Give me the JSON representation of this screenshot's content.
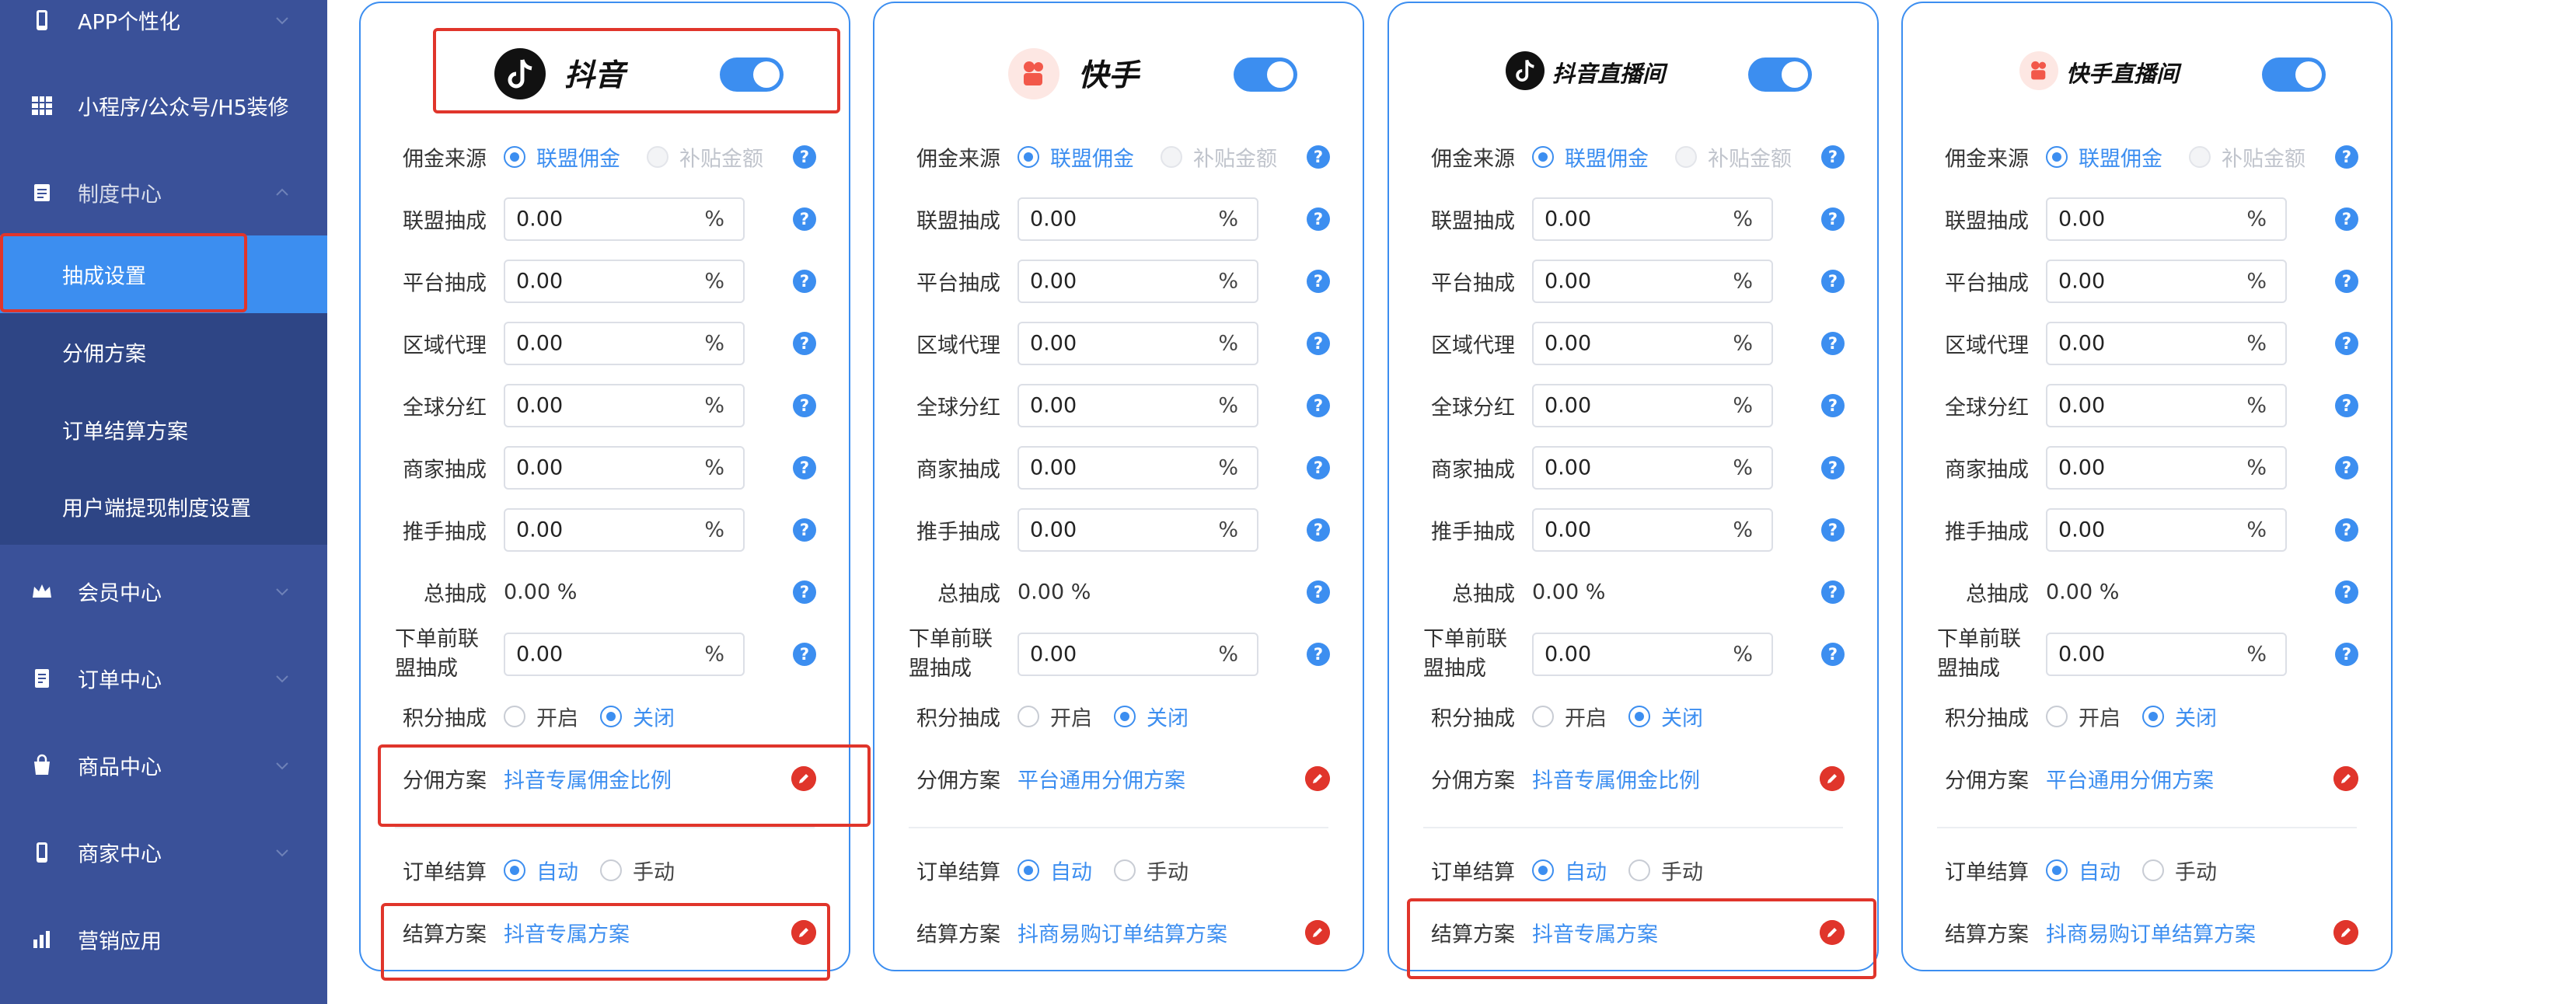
{
  "sidebar": {
    "items": [
      {
        "label": "APP个性化",
        "icon": "phone-icon"
      },
      {
        "label": "小程序/公众号/H5装修",
        "icon": "grid-icon"
      },
      {
        "label": "制度中心",
        "icon": "document-icon"
      },
      {
        "label": "会员中心",
        "icon": "crown-icon"
      },
      {
        "label": "订单中心",
        "icon": "order-icon"
      },
      {
        "label": "商品中心",
        "icon": "bag-icon"
      },
      {
        "label": "商家中心",
        "icon": "phone-icon"
      },
      {
        "label": "营销应用",
        "icon": "chart-icon"
      }
    ],
    "subitems": [
      {
        "label": "抽成设置",
        "active": true
      },
      {
        "label": "分佣方案"
      },
      {
        "label": "订单结算方案"
      },
      {
        "label": "用户端提现制度设置"
      }
    ]
  },
  "labels": {
    "commission_source": "佣金来源",
    "alliance": "联盟抽成",
    "platform": "平台抽成",
    "region": "区域代理",
    "global": "全球分红",
    "merchant": "商家抽成",
    "promoter": "推手抽成",
    "total": "总抽成",
    "pre_order": "下单前联盟抽成",
    "points": "积分抽成",
    "commission_plan": "分佣方案",
    "order_settle": "订单结算",
    "settle_plan": "结算方案",
    "opt_alliance_commission": "联盟佣金",
    "opt_subsidy": "补贴金额",
    "opt_on": "开启",
    "opt_off": "关闭",
    "opt_auto": "自动",
    "opt_manual": "手动",
    "percent": "%",
    "help": "?"
  },
  "colors": {
    "accent": "#3c8ef0",
    "sidebar": "#3a5199",
    "highlight": "#e0352b"
  },
  "cards": [
    {
      "name": "抖音",
      "enabled": true,
      "alliance": "0.00",
      "platform": "0.00",
      "region": "0.00",
      "global": "0.00",
      "merchant": "0.00",
      "promoter": "0.00",
      "total": "0.00 %",
      "pre_order": "0.00",
      "commission_plan": "抖音专属佣金比例",
      "settle_plan": "抖音专属方案"
    },
    {
      "name": "快手",
      "enabled": true,
      "alliance": "0.00",
      "platform": "0.00",
      "region": "0.00",
      "global": "0.00",
      "merchant": "0.00",
      "promoter": "0.00",
      "total": "0.00 %",
      "pre_order": "0.00",
      "commission_plan": "平台通用分佣方案",
      "settle_plan": "抖商易购订单结算方案"
    },
    {
      "name": "抖音直播间",
      "enabled": true,
      "alliance": "0.00",
      "platform": "0.00",
      "region": "0.00",
      "global": "0.00",
      "merchant": "0.00",
      "promoter": "0.00",
      "total": "0.00 %",
      "pre_order": "0.00",
      "commission_plan": "抖音专属佣金比例",
      "settle_plan": "抖音专属方案"
    },
    {
      "name": "快手直播间",
      "enabled": true,
      "alliance": "0.00",
      "platform": "0.00",
      "region": "0.00",
      "global": "0.00",
      "merchant": "0.00",
      "promoter": "0.00",
      "total": "0.00 %",
      "pre_order": "0.00",
      "commission_plan": "平台通用分佣方案",
      "settle_plan": "抖商易购订单结算方案"
    }
  ]
}
